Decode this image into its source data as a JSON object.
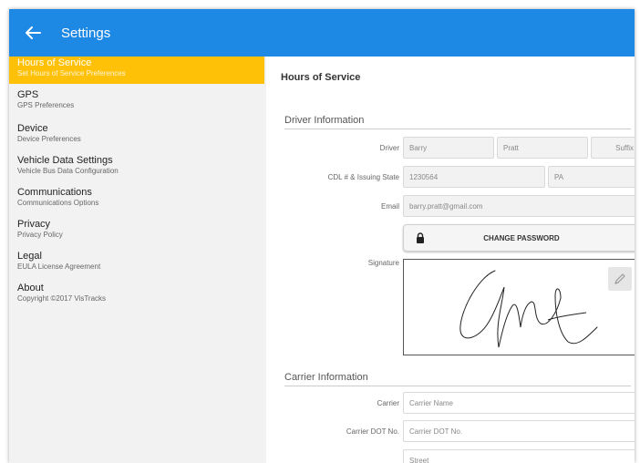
{
  "appbar": {
    "title": "Settings",
    "back_icon": "back-arrow-icon",
    "color": "#1e88e5"
  },
  "sidebar": {
    "accent": "#ffc107",
    "items": [
      {
        "title": "Hours of Service",
        "subtitle": "Set Hours of Service Preferences",
        "active": true
      },
      {
        "title": "GPS",
        "subtitle": "GPS Preferences"
      },
      {
        "title": "Device",
        "subtitle": "Device Preferences"
      },
      {
        "title": "Vehicle Data Settings",
        "subtitle": "Vehicle Bus Data Configuration"
      },
      {
        "title": "Communications",
        "subtitle": "Communications Options"
      },
      {
        "title": "Privacy",
        "subtitle": "Privacy Policy"
      },
      {
        "title": "Legal",
        "subtitle": "EULA License Agreement"
      },
      {
        "title": "About",
        "subtitle": "Copyright ©2017 VisTracks"
      }
    ]
  },
  "main": {
    "page_title": "Hours of Service",
    "driver_section": {
      "title": "Driver Information",
      "driver_label": "Driver",
      "first_name": "Barry",
      "last_name": "Pratt",
      "suffix_placeholder": "Suffix",
      "cdl_label": "CDL # & Issuing State",
      "cdl_number": "1230564",
      "cdl_state": "PA",
      "email_label": "Email",
      "email": "barry.pratt@gmail.com",
      "change_password_label": "CHANGE PASSWORD",
      "signature_label": "Signature"
    },
    "carrier_section": {
      "title": "Carrier Information",
      "carrier_label": "Carrier",
      "carrier_placeholder": "Carrier Name",
      "dot_label": "Carrier DOT No.",
      "dot_placeholder": "Carrier DOT No.",
      "street_placeholder": "Street"
    }
  }
}
